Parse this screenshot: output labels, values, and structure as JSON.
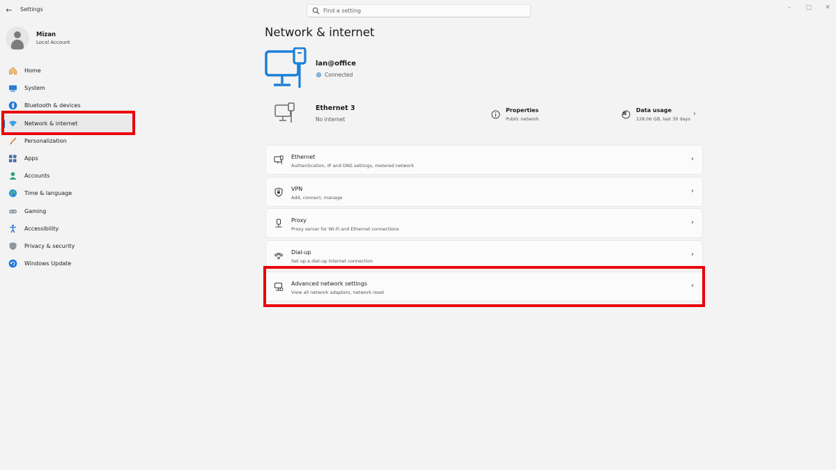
{
  "window": {
    "title": "Settings",
    "back_glyph": "←",
    "minimize_glyph": "–",
    "maximize_glyph": "▢",
    "close_glyph": "✕"
  },
  "search": {
    "placeholder": "Find a setting"
  },
  "profile": {
    "name": "Mizan",
    "account_type": "Local Account"
  },
  "sidebar": {
    "items": [
      {
        "label": "Home",
        "icon": "home-icon",
        "active": false
      },
      {
        "label": "System",
        "icon": "system-icon",
        "active": false
      },
      {
        "label": "Bluetooth & devices",
        "icon": "bluetooth-icon",
        "active": false
      },
      {
        "label": "Network & internet",
        "icon": "network-icon",
        "active": true
      },
      {
        "label": "Personalization",
        "icon": "brush-icon",
        "active": false
      },
      {
        "label": "Apps",
        "icon": "apps-icon",
        "active": false
      },
      {
        "label": "Accounts",
        "icon": "accounts-icon",
        "active": false
      },
      {
        "label": "Time & language",
        "icon": "globe-icon",
        "active": false
      },
      {
        "label": "Gaming",
        "icon": "gamepad-icon",
        "active": false
      },
      {
        "label": "Accessibility",
        "icon": "accessibility-icon",
        "active": false
      },
      {
        "label": "Privacy & security",
        "icon": "shield-icon",
        "active": false
      },
      {
        "label": "Windows Update",
        "icon": "update-icon",
        "active": false
      }
    ]
  },
  "main": {
    "title": "Network & internet",
    "connection": {
      "name": "lan@office",
      "status": "Connected"
    },
    "adapter": {
      "name": "Ethernet 3",
      "status": "No internet"
    },
    "properties": {
      "title": "Properties",
      "subtitle": "Public network"
    },
    "data_usage": {
      "title": "Data usage",
      "subtitle": "128.06 GB, last 30 days"
    },
    "cards": [
      {
        "title": "Ethernet",
        "subtitle": "Authentication, IP and DNS settings, metered network",
        "icon": "ethernet-icon"
      },
      {
        "title": "VPN",
        "subtitle": "Add, connect, manage",
        "icon": "vpn-shield-icon"
      },
      {
        "title": "Proxy",
        "subtitle": "Proxy server for Wi-Fi and Ethernet connections",
        "icon": "proxy-icon"
      },
      {
        "title": "Dial-up",
        "subtitle": "Set up a dial-up internet connection",
        "icon": "dialup-icon"
      },
      {
        "title": "Advanced network settings",
        "subtitle": "View all network adapters, network reset",
        "icon": "advanced-network-icon"
      }
    ],
    "chevron_glyph": "›"
  },
  "colors": {
    "accent": "#0067c0",
    "highlight": "#e8000b",
    "background": "#f3f3f3",
    "card": "#fbfbfb"
  }
}
